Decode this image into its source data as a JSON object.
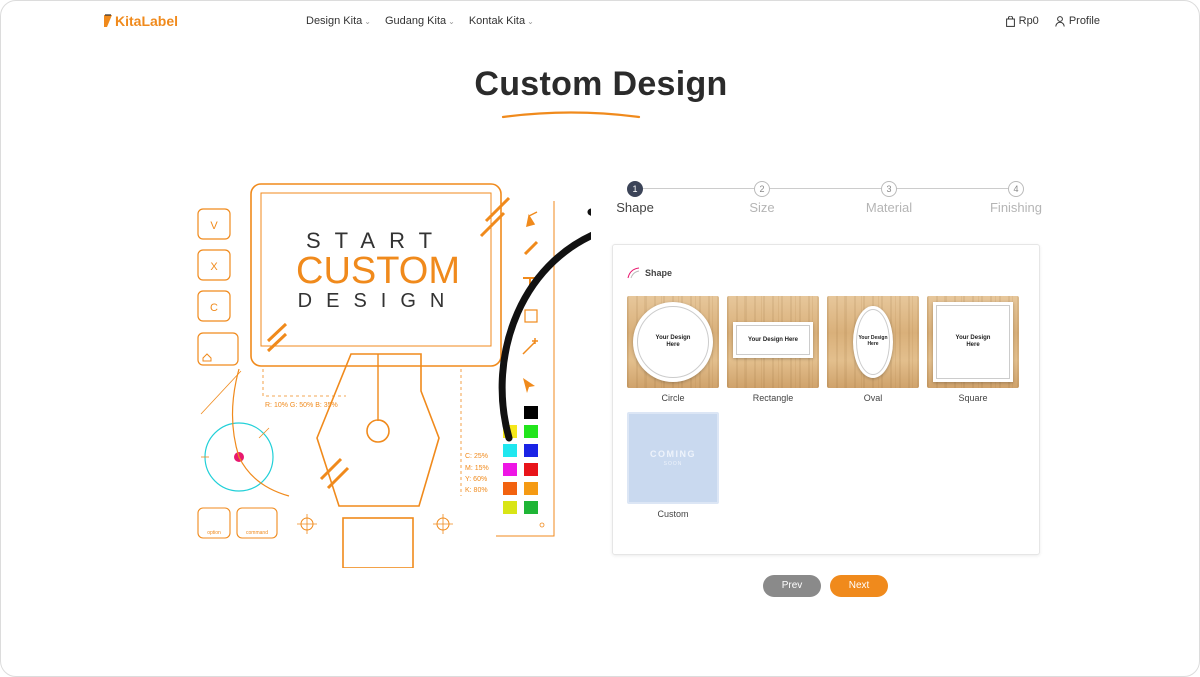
{
  "brand": {
    "name": "KitaLabel",
    "color": "#f08a1c"
  },
  "nav": {
    "menu": [
      {
        "label": "Design Kita"
      },
      {
        "label": "Gudang Kita"
      },
      {
        "label": "Kontak Kita"
      }
    ],
    "cart_label": "Rp0",
    "profile_label": "Profile"
  },
  "page": {
    "title": "Custom Design"
  },
  "illustration": {
    "line1": "START",
    "line2": "CUSTOM",
    "line3": "DESIGN",
    "keys": [
      "V",
      "X",
      "C"
    ],
    "rgb_text": "R: 10% G: 50% B: 35%",
    "cmyk": [
      "C: 25%",
      "M: 15%",
      "Y: 60%",
      "K: 80%"
    ],
    "mod_keys": [
      "option",
      "command"
    ]
  },
  "stepper": {
    "active_index": 0,
    "steps": [
      {
        "number": "1",
        "label": "Shape"
      },
      {
        "number": "2",
        "label": "Size"
      },
      {
        "number": "3",
        "label": "Material"
      },
      {
        "number": "4",
        "label": "Finishing"
      }
    ]
  },
  "shape_card": {
    "header": "Shape",
    "label_text": "Your Design Here",
    "options": [
      {
        "label": "Circle"
      },
      {
        "label": "Rectangle"
      },
      {
        "label": "Oval"
      },
      {
        "label": "Square"
      },
      {
        "label": "Custom",
        "badge": "COMING",
        "badge_sub": "SOON"
      }
    ]
  },
  "actions": {
    "prev_label": "Prev",
    "next_label": "Next"
  }
}
